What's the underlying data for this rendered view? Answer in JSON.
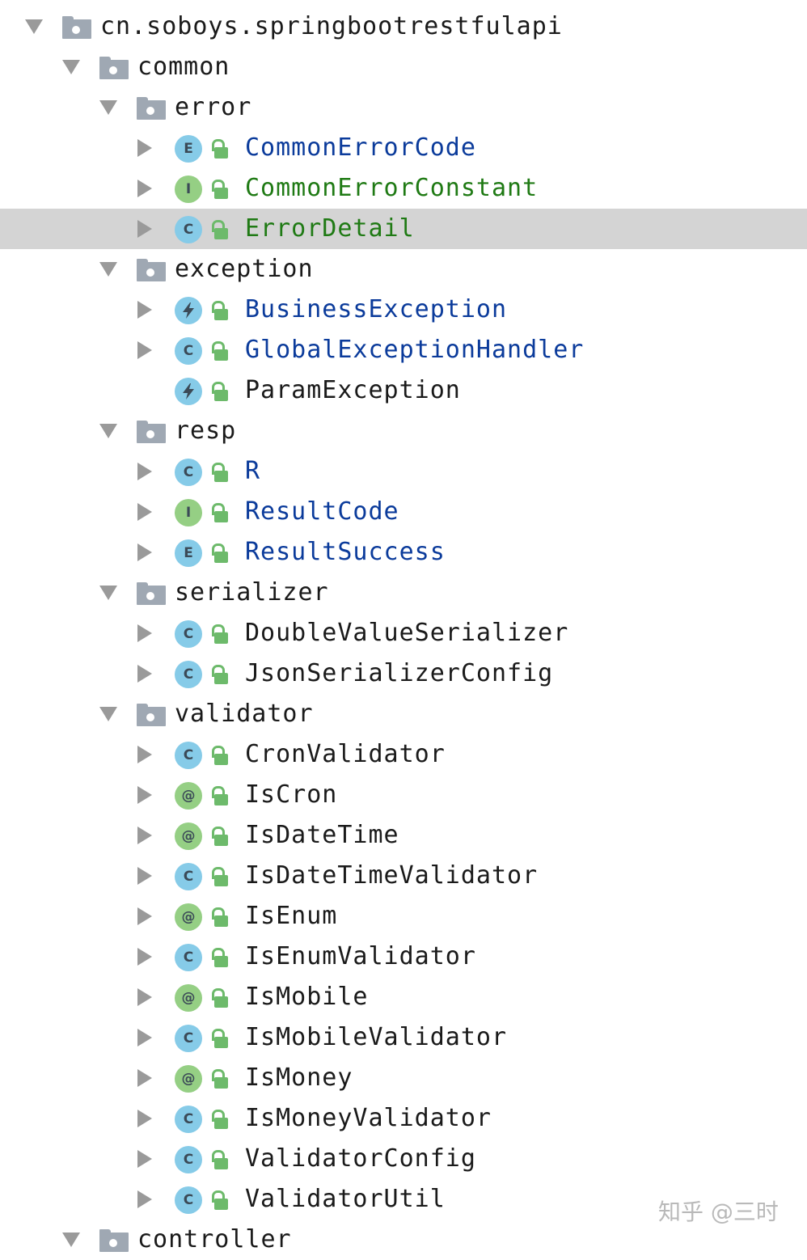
{
  "colors": {
    "blue_text": "#0b3b9b",
    "green_text": "#1f7a14",
    "default_text": "#1a1a1a",
    "class_icon_bg": "#86cbe8",
    "interface_icon_bg": "#95cf84",
    "selected_row_bg": "#d4d4d4"
  },
  "tree": [
    {
      "type": "package",
      "depth": 0,
      "expanded": true,
      "label": "cn.soboys.springbootrestfulapi",
      "name": "package-root"
    },
    {
      "type": "package",
      "depth": 1,
      "expanded": true,
      "label": "common",
      "name": "package-common"
    },
    {
      "type": "package",
      "depth": 2,
      "expanded": true,
      "label": "error",
      "name": "package-error"
    },
    {
      "type": "class",
      "kind": "E",
      "icon": "enum-icon",
      "label": "CommonErrorCode",
      "color": "blue",
      "arrow": true
    },
    {
      "type": "class",
      "kind": "I",
      "icon": "interface-icon",
      "label": "CommonErrorConstant",
      "color": "green",
      "arrow": true
    },
    {
      "type": "class",
      "kind": "C",
      "icon": "class-icon",
      "label": "ErrorDetail",
      "color": "green",
      "arrow": true,
      "selected": true
    },
    {
      "type": "package",
      "depth": 2,
      "expanded": true,
      "label": "exception",
      "name": "package-exception"
    },
    {
      "type": "class",
      "kind": "X",
      "icon": "exception-icon",
      "label": "BusinessException",
      "color": "blue",
      "arrow": true
    },
    {
      "type": "class",
      "kind": "C",
      "icon": "class-icon",
      "label": "GlobalExceptionHandler",
      "color": "blue",
      "arrow": true
    },
    {
      "type": "class",
      "kind": "X",
      "icon": "exception-icon",
      "label": "ParamException",
      "color": "default",
      "arrow": false
    },
    {
      "type": "package",
      "depth": 2,
      "expanded": true,
      "label": "resp",
      "name": "package-resp"
    },
    {
      "type": "class",
      "kind": "C",
      "icon": "class-icon",
      "label": "R",
      "color": "blue",
      "arrow": true
    },
    {
      "type": "class",
      "kind": "I",
      "icon": "interface-icon",
      "label": "ResultCode",
      "color": "blue",
      "arrow": true
    },
    {
      "type": "class",
      "kind": "E",
      "icon": "enum-icon",
      "label": "ResultSuccess",
      "color": "blue",
      "arrow": true
    },
    {
      "type": "package",
      "depth": 2,
      "expanded": true,
      "label": "serializer",
      "name": "package-serializer"
    },
    {
      "type": "class",
      "kind": "C",
      "icon": "class-icon",
      "label": "DoubleValueSerializer",
      "color": "default",
      "arrow": true
    },
    {
      "type": "class",
      "kind": "C",
      "icon": "class-icon",
      "label": "JsonSerializerConfig",
      "color": "default",
      "arrow": true
    },
    {
      "type": "package",
      "depth": 2,
      "expanded": true,
      "label": "validator",
      "name": "package-validator"
    },
    {
      "type": "class",
      "kind": "C",
      "icon": "class-icon",
      "label": "CronValidator",
      "color": "default",
      "arrow": true
    },
    {
      "type": "class",
      "kind": "@",
      "icon": "annotation-icon",
      "label": "IsCron",
      "color": "default",
      "arrow": true
    },
    {
      "type": "class",
      "kind": "@",
      "icon": "annotation-icon",
      "label": "IsDateTime",
      "color": "default",
      "arrow": true
    },
    {
      "type": "class",
      "kind": "C",
      "icon": "class-icon",
      "label": "IsDateTimeValidator",
      "color": "default",
      "arrow": true
    },
    {
      "type": "class",
      "kind": "@",
      "icon": "annotation-icon",
      "label": "IsEnum",
      "color": "default",
      "arrow": true
    },
    {
      "type": "class",
      "kind": "C",
      "icon": "class-icon",
      "label": "IsEnumValidator",
      "color": "default",
      "arrow": true
    },
    {
      "type": "class",
      "kind": "@",
      "icon": "annotation-icon",
      "label": "IsMobile",
      "color": "default",
      "arrow": true
    },
    {
      "type": "class",
      "kind": "C",
      "icon": "class-icon",
      "label": "IsMobileValidator",
      "color": "default",
      "arrow": true
    },
    {
      "type": "class",
      "kind": "@",
      "icon": "annotation-icon",
      "label": "IsMoney",
      "color": "default",
      "arrow": true
    },
    {
      "type": "class",
      "kind": "C",
      "icon": "class-icon",
      "label": "IsMoneyValidator",
      "color": "default",
      "arrow": true
    },
    {
      "type": "class",
      "kind": "C",
      "icon": "class-icon",
      "label": "ValidatorConfig",
      "color": "default",
      "arrow": true
    },
    {
      "type": "class",
      "kind": "C",
      "icon": "class-icon",
      "label": "ValidatorUtil",
      "color": "default",
      "arrow": true
    },
    {
      "type": "package",
      "depth": 1,
      "expanded": true,
      "label": "controller",
      "name": "package-controller"
    }
  ],
  "watermark": "知乎 @三时"
}
